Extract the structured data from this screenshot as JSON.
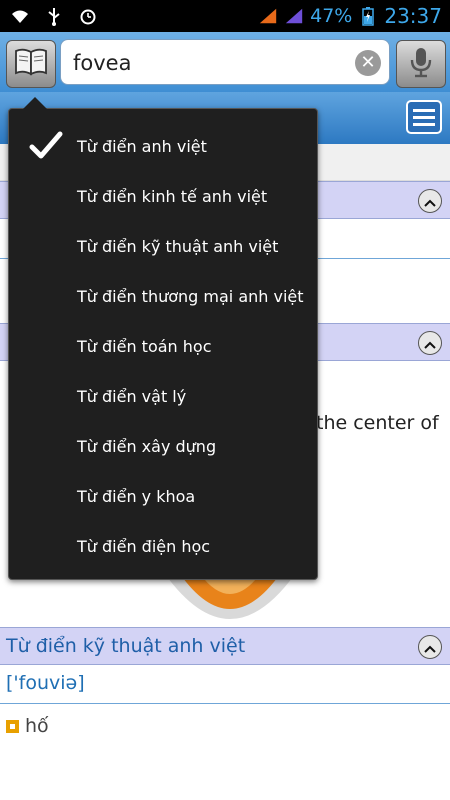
{
  "status_bar": {
    "battery_percent": "47%",
    "time": "23:37"
  },
  "search": {
    "query": "fovea"
  },
  "dictionary_menu": {
    "selected_index": 0,
    "items": [
      {
        "label": "Từ điển anh việt"
      },
      {
        "label": "Từ điển kinh tế anh việt"
      },
      {
        "label": "Từ điển kỹ thuật anh việt"
      },
      {
        "label": "Từ điển thương mại anh việt"
      },
      {
        "label": "Từ điển toán học"
      },
      {
        "label": "Từ điển vật lý"
      },
      {
        "label": "Từ điển xây dựng"
      },
      {
        "label": "Từ điển y khoa"
      },
      {
        "label": "Từ điển điện học"
      }
    ]
  },
  "content": {
    "partial_text": "the center of",
    "section_technical": {
      "title": "Từ điển kỹ thuật anh việt",
      "pronunciation": "['fouviə]",
      "meaning": "hố"
    }
  },
  "colors": {
    "accent": "#3f8ed3",
    "status_text": "#3ea8ea",
    "section_head_bg": "#d3d3f5"
  }
}
